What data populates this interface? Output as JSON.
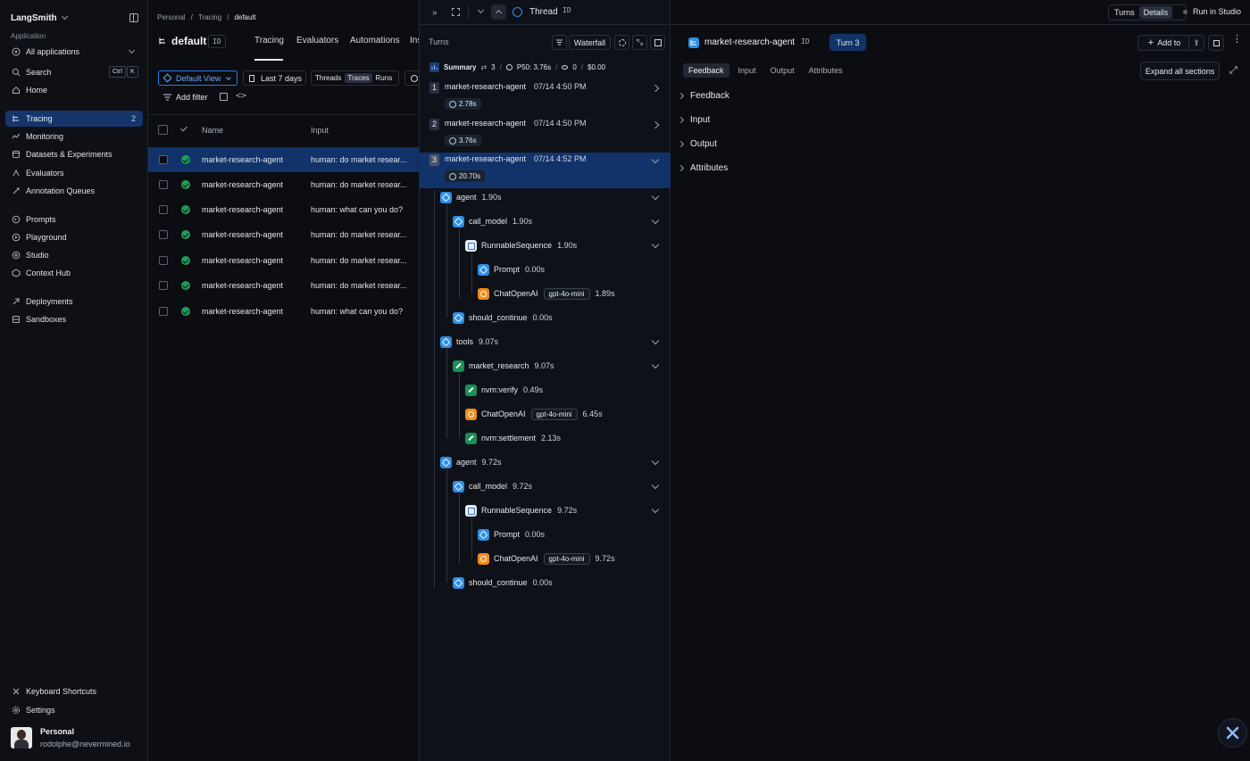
{
  "sidebar": {
    "brand": "LangSmith",
    "section_label": "Application",
    "app_select": "All applications",
    "search": {
      "label": "Search",
      "kbd": [
        "Ctrl",
        "K"
      ]
    },
    "items": [
      {
        "label": "Home",
        "icon": "home-icon"
      },
      {
        "label": "Tracing",
        "icon": "tracing-icon",
        "count": "2",
        "active": true
      },
      {
        "label": "Monitoring",
        "icon": "monitoring-icon"
      },
      {
        "label": "Datasets & Experiments",
        "icon": "datasets-icon"
      },
      {
        "label": "Evaluators",
        "icon": "evaluators-icon"
      },
      {
        "label": "Annotation Queues",
        "icon": "annotation-icon"
      },
      {
        "label": "Prompts",
        "icon": "prompts-icon"
      },
      {
        "label": "Playground",
        "icon": "playground-icon"
      },
      {
        "label": "Studio",
        "icon": "studio-icon"
      },
      {
        "label": "Context Hub",
        "icon": "hub-icon"
      },
      {
        "label": "Deployments",
        "icon": "deployments-icon"
      },
      {
        "label": "Sandboxes",
        "icon": "sandboxes-icon"
      }
    ],
    "footer": {
      "shortcuts": "Keyboard Shortcuts",
      "settings": "Settings",
      "user_name": "Personal",
      "user_email": "rodolphe@nevermined.io"
    }
  },
  "center": {
    "breadcrumb": [
      "Personal",
      "Tracing",
      "default"
    ],
    "project_title": "default",
    "id_badge": "ID",
    "tabs": [
      "Tracing",
      "Evaluators",
      "Automations",
      "Ins"
    ],
    "view_select": "Default View",
    "date_filter": "Last 7 days",
    "segments": [
      "Threads",
      "Traces",
      "Runs"
    ],
    "add_filter": "Add filter",
    "columns": [
      "Name",
      "Input"
    ],
    "rows": [
      {
        "name": "market-research-agent",
        "input": "human: do market resear..."
      },
      {
        "name": "market-research-agent",
        "input": "human: do market resear..."
      },
      {
        "name": "market-research-agent",
        "input": "human: what can you do?"
      },
      {
        "name": "market-research-agent",
        "input": "human: do market resear..."
      },
      {
        "name": "market-research-agent",
        "input": "human: do market resear..."
      },
      {
        "name": "market-research-agent",
        "input": "human: do market resear..."
      },
      {
        "name": "market-research-agent",
        "input": "human: what can you do?"
      }
    ]
  },
  "thread": {
    "title": "Thread",
    "id_badge": "ID",
    "turns_label": "Turns",
    "waterfall": "Waterfall",
    "summary": {
      "label": "Summary",
      "count": "3",
      "p50": "P50: 3.76s",
      "tokens": "0",
      "cost": "$0.00"
    },
    "turns": [
      {
        "num": "1",
        "name": "market-research-agent",
        "date": "07/14 4:50 PM",
        "duration": "2.78s"
      },
      {
        "num": "2",
        "name": "market-research-agent",
        "date": "07/14 4:50 PM",
        "duration": "3.76s"
      },
      {
        "num": "3",
        "name": "market-research-agent",
        "date": "07/14 4:52 PM",
        "duration": "20.70s"
      }
    ],
    "tree": [
      {
        "label": "agent",
        "dur": "1.90s",
        "type": "chain"
      },
      {
        "label": "call_model",
        "dur": "1.90s",
        "type": "chain"
      },
      {
        "label": "RunnableSequence",
        "dur": "1.90s",
        "type": "seq"
      },
      {
        "label": "Prompt",
        "dur": "0.00s",
        "type": "chain"
      },
      {
        "label": "ChatOpenAI",
        "dur": "1.89s",
        "type": "llm",
        "tag": "gpt-4o-mini"
      },
      {
        "label": "should_continue",
        "dur": "0.00s",
        "type": "chain"
      },
      {
        "label": "tools",
        "dur": "9.07s",
        "type": "chain"
      },
      {
        "label": "market_research",
        "dur": "9.07s",
        "type": "tool"
      },
      {
        "label": "nvm:verify",
        "dur": "0.49s",
        "type": "tool"
      },
      {
        "label": "ChatOpenAI",
        "dur": "6.45s",
        "type": "llm",
        "tag": "gpt-4o-mini"
      },
      {
        "label": "nvm:settlement",
        "dur": "2.13s",
        "type": "tool"
      },
      {
        "label": "agent",
        "dur": "9.72s",
        "type": "chain"
      },
      {
        "label": "call_model",
        "dur": "9.72s",
        "type": "chain"
      },
      {
        "label": "RunnableSequence",
        "dur": "9.72s",
        "type": "seq"
      },
      {
        "label": "Prompt",
        "dur": "0.00s",
        "type": "chain"
      },
      {
        "label": "ChatOpenAI",
        "dur": "9.72s",
        "type": "llm",
        "tag": "gpt-4o-mini"
      },
      {
        "label": "should_continue",
        "dur": "0.00s",
        "type": "chain"
      }
    ]
  },
  "details": {
    "top_buttons": [
      "Turns",
      "Details",
      "Run in Studio"
    ],
    "run_name": "market-research-agent",
    "id_badge": "ID",
    "turn_badge": "Turn 3",
    "add_to": "Add to",
    "tabs": [
      "Feedback",
      "Input",
      "Output",
      "Attributes"
    ],
    "expand_all": "Expand all sections",
    "sections": [
      "Feedback",
      "Input",
      "Output",
      "Attributes"
    ]
  },
  "colors": {
    "accent": "#2f8fe6",
    "selected_row": "#12336a",
    "success": "#1f9d57",
    "llm": "#f08c1a",
    "tool": "#1b8f58"
  }
}
